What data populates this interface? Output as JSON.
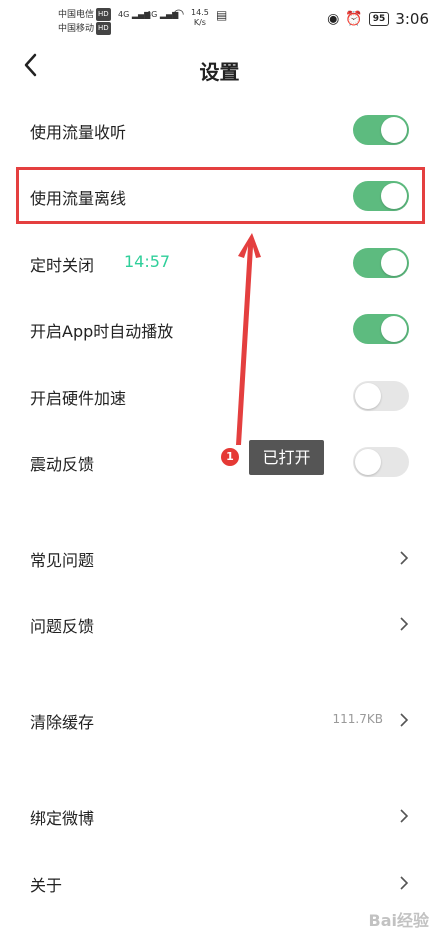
{
  "status_bar": {
    "carrier1": "中国电信",
    "carrier2": "中国移动",
    "hd": "HD",
    "net1": "4G",
    "net2": "4G",
    "speed_value": "14.5",
    "speed_unit": "K/s",
    "battery": "95",
    "time": "3:06"
  },
  "header": {
    "title": "设置"
  },
  "settings": {
    "streaming": {
      "label": "使用流量收听",
      "enabled": true
    },
    "offline": {
      "label": "使用流量离线",
      "enabled": true
    },
    "timer": {
      "label": "定时关闭",
      "value": "14:57",
      "enabled": true
    },
    "autoplay": {
      "label": "开启App时自动播放",
      "enabled": true
    },
    "hw_accel": {
      "label": "开启硬件加速",
      "enabled": false
    },
    "vibration": {
      "label": "震动反馈",
      "enabled": false
    }
  },
  "links": {
    "faq": "常见问题",
    "feedback": "问题反馈",
    "clear_cache": {
      "label": "清除缓存",
      "value": "111.7KB"
    },
    "weibo": "绑定微博",
    "about": "关于"
  },
  "annotation": {
    "step": "1",
    "text": "已打开",
    "color": "#e43f3f"
  },
  "watermark": "Bai经验"
}
